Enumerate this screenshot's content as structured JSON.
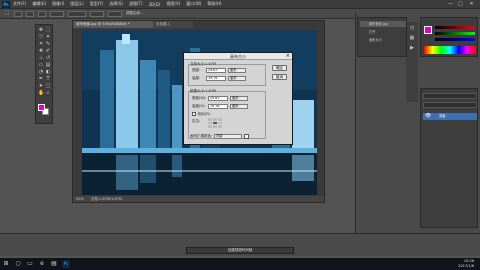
{
  "app": {
    "logo": "Ps"
  },
  "menubar": {
    "items": [
      "文件(F)",
      "编辑(E)",
      "图像(I)",
      "图层(L)",
      "类型(Y)",
      "选择(S)",
      "滤镜(T)",
      "3D(D)",
      "视图(V)",
      "窗口(W)",
      "帮助(H)"
    ]
  },
  "window_controls": {
    "minimize": "—",
    "maximize": "□",
    "close": "✕"
  },
  "options_bar": {
    "label": "调整边缘..."
  },
  "document": {
    "tab_title": "城市夜景.jpg @ 50%(RGB/8#) *",
    "tab2_title": "未标题-1",
    "zoom": "50%",
    "doc_size": "文档:1.67M/1.67M"
  },
  "dialog": {
    "title": "画布大小",
    "current_size_label": "当前大小:1.67M",
    "cur_width_label": "宽度:",
    "cur_width_value": "29.63",
    "cur_width_unit": "厘米",
    "cur_height_label": "高度:",
    "cur_height_value": "19.76",
    "cur_height_unit": "厘米",
    "new_size_label": "新建大小:1.67M",
    "new_width_label": "宽度(W):",
    "new_width_value": "29.63",
    "new_width_unit": "厘米",
    "new_height_label": "高度(H):",
    "new_height_value": "19.76",
    "new_height_unit": "厘米",
    "relative_label": "相对(R)",
    "anchor_label": "定位:",
    "ext_color_label": "画布扩展颜色:",
    "ext_color_value": "背景",
    "ok_label": "确定",
    "cancel_label": "取消"
  },
  "history_panel": {
    "rows": [
      "城市夜景.jpg",
      "打开",
      "画布大小"
    ]
  },
  "layers_panel": {
    "layer_name": "背景"
  },
  "timeline": {
    "button_label": "创建视频时间轴"
  },
  "taskbar": {
    "clock_time": "10:26",
    "clock_date": "2017/1/6"
  },
  "colors": {
    "foreground": "#e000c8",
    "background": "#ffffff",
    "selected_layer": "#3f6fae"
  }
}
